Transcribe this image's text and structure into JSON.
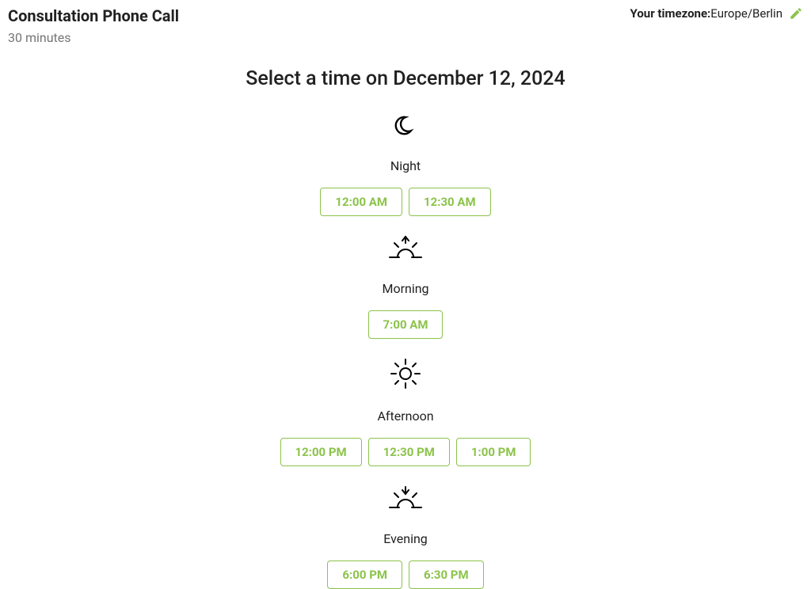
{
  "header": {
    "title": "Consultation Phone Call",
    "duration": "30 minutes",
    "timezone_label": "Your timezone:",
    "timezone_value": "Europe/Berlin"
  },
  "select_title": "Select a time on December 12, 2024",
  "periods": [
    {
      "id": "night",
      "label": "Night",
      "icon": "moon-icon",
      "slots": [
        "12:00 AM",
        "12:30 AM"
      ]
    },
    {
      "id": "morning",
      "label": "Morning",
      "icon": "sunrise-icon",
      "slots": [
        "7:00 AM"
      ]
    },
    {
      "id": "afternoon",
      "label": "Afternoon",
      "icon": "sun-icon",
      "slots": [
        "12:00 PM",
        "12:30 PM",
        "1:00 PM"
      ]
    },
    {
      "id": "evening",
      "label": "Evening",
      "icon": "sunset-icon",
      "slots": [
        "6:00 PM",
        "6:30 PM"
      ]
    }
  ],
  "colors": {
    "accent": "#8bc34a",
    "text": "#212121",
    "muted": "#757575"
  }
}
